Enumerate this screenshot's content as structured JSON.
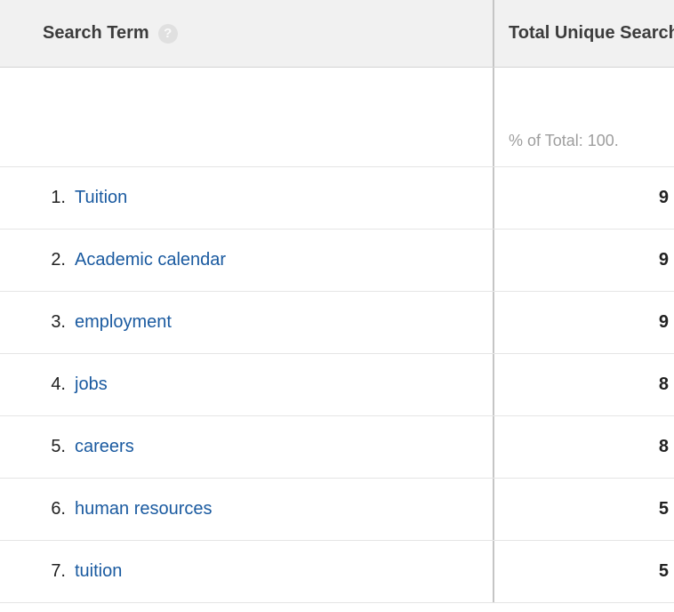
{
  "header": {
    "left_label": "Search Term",
    "right_label": "Total Unique Search"
  },
  "summary": {
    "percent_label": "% of Total: 100."
  },
  "rows": [
    {
      "num": "1.",
      "term": "Tuition",
      "value": "9"
    },
    {
      "num": "2.",
      "term": "Academic calendar",
      "value": "9"
    },
    {
      "num": "3.",
      "term": "employment",
      "value": "9"
    },
    {
      "num": "4.",
      "term": "jobs",
      "value": "8"
    },
    {
      "num": "5.",
      "term": "careers",
      "value": "8"
    },
    {
      "num": "6.",
      "term": "human resources",
      "value": "5"
    },
    {
      "num": "7.",
      "term": "tuition",
      "value": "5"
    }
  ]
}
